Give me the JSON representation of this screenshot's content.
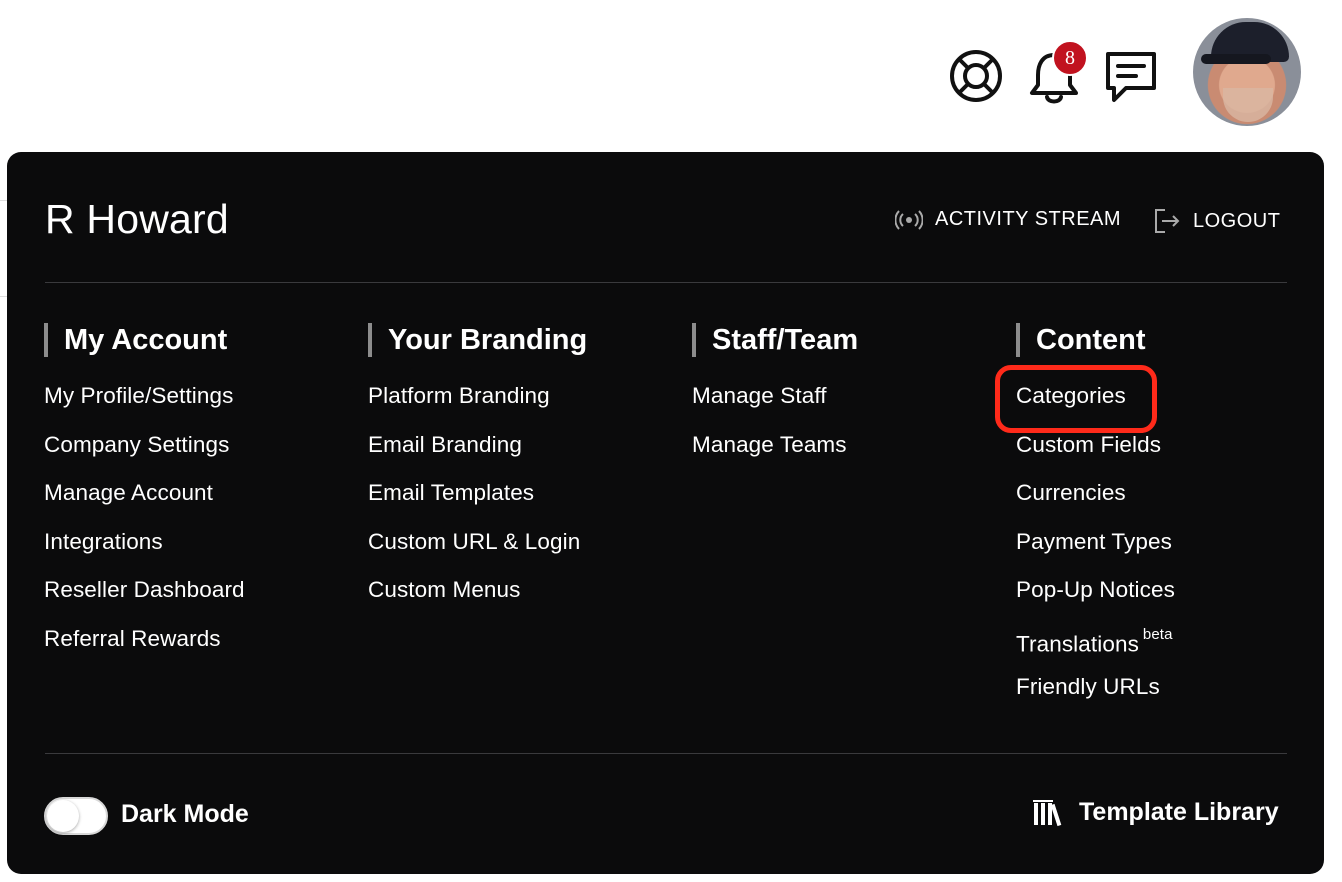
{
  "topbar": {
    "icons": [
      "lifebuoy-icon",
      "bell-icon",
      "chat-icon"
    ],
    "notification_count": "8",
    "badge_color": "#c1121f"
  },
  "panel": {
    "user_name": "R Howard",
    "activity_stream_label": "ACTIVITY STREAM",
    "logout_label": "LOGOUT",
    "columns": [
      {
        "title": "My Account",
        "items": [
          "My Profile/Settings",
          "Company Settings",
          "Manage Account",
          "Integrations",
          "Reseller Dashboard",
          "Referral Rewards"
        ]
      },
      {
        "title": "Your Branding",
        "items": [
          "Platform Branding",
          "Email Branding",
          "Email Templates",
          "Custom URL & Login",
          "Custom Menus"
        ]
      },
      {
        "title": "Staff/Team",
        "items": [
          "Manage Staff",
          "Manage Teams"
        ]
      },
      {
        "title": "Content",
        "items": [
          "Categories",
          "Custom Fields",
          "Currencies",
          "Payment Types",
          "Pop-Up Notices",
          "Translations",
          "Friendly URLs"
        ],
        "translations_badge": "beta"
      }
    ],
    "dark_mode_label": "Dark Mode",
    "dark_mode_on": false,
    "template_library_label": "Template Library",
    "highlight_color": "#ff2a1a",
    "background_color": "#0b0b0c"
  }
}
